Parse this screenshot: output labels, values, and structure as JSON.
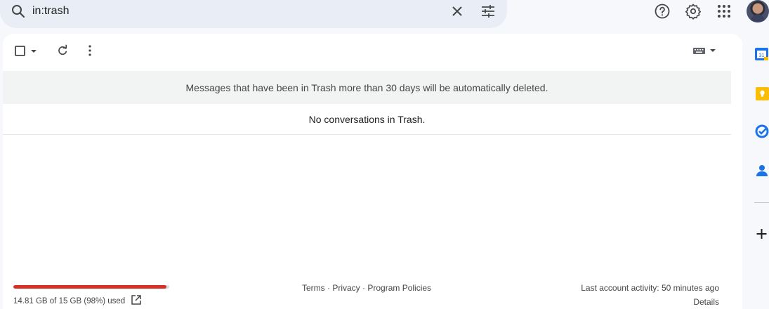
{
  "search": {
    "query": "in:trash"
  },
  "toolbar": {
    "select_label": "",
    "refresh_label": "",
    "more_label": ""
  },
  "notice": "Messages that have been in Trash more than 30 days will be automatically deleted.",
  "empty_message": "No conversations in Trash.",
  "storage": {
    "text": "14.81 GB of 15 GB (98%) used",
    "fraction": 0.98,
    "bar_color": "#d93025"
  },
  "footer": {
    "terms": "Terms",
    "privacy": "Privacy",
    "policies": "Program Policies",
    "sep": " · "
  },
  "activity": {
    "text": "Last account activity: 50 minutes ago",
    "details": "Details"
  },
  "side_apps": {
    "calendar_day": "31",
    "icons": [
      "calendar-icon",
      "keep-icon",
      "tasks-icon",
      "contacts-icon",
      "add-icon"
    ]
  },
  "colors": {
    "accent_blue": "#0b57d0",
    "keep_yellow": "#fbbc04",
    "calendar_blue": "#1a73e8"
  }
}
